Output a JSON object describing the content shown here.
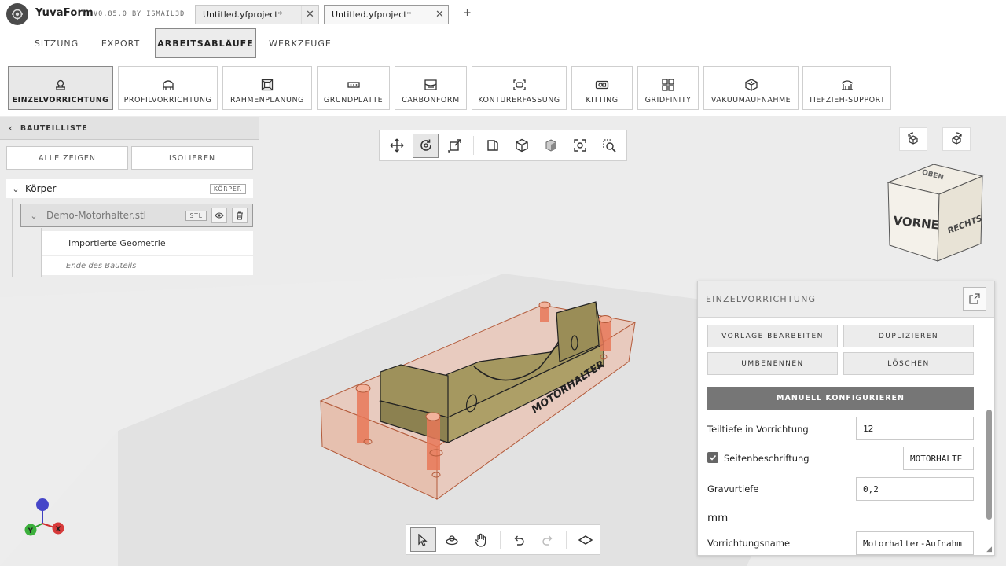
{
  "app": {
    "name": "YuvaForm",
    "version": "V0.85.0 BY ISMAIL3D"
  },
  "doc_tabs": [
    {
      "label": "Untitled.yfproject",
      "modified": "*"
    },
    {
      "label": "Untitled.yfproject",
      "modified": "*"
    }
  ],
  "new_tab_label": "+",
  "menu_tabs": [
    "SITZUNG",
    "EXPORT",
    "ARBEITSABLÄUFE",
    "WERKZEUGE"
  ],
  "active_menu_tab": "ARBEITSABLÄUFE",
  "ribbon": [
    {
      "label": "EINZELVORRICHTUNG",
      "icon": "single-fixture-icon",
      "active": true
    },
    {
      "label": "PROFILVORRICHTUNG",
      "icon": "profile-fixture-icon"
    },
    {
      "label": "RAHMENPLANUNG",
      "icon": "frame-planning-icon"
    },
    {
      "label": "GRUNDPLATTE",
      "icon": "baseplate-icon"
    },
    {
      "label": "CARBONFORM",
      "icon": "carbon-form-icon"
    },
    {
      "label": "KONTURERFASSUNG",
      "icon": "contour-capture-icon"
    },
    {
      "label": "KITTING",
      "icon": "kitting-icon"
    },
    {
      "label": "GRIDFINITY",
      "icon": "gridfinity-icon"
    },
    {
      "label": "VAKUUMAUFNAHME",
      "icon": "vacuum-fixture-icon"
    },
    {
      "label": "TIEFZIEH-SUPPORT",
      "icon": "thermoform-support-icon"
    }
  ],
  "sidebar": {
    "title": "BAUTEILLISTE",
    "show_all": "ALLE ZEIGEN",
    "isolate": "ISOLIEREN",
    "group": {
      "label": "Körper",
      "tag": "KÖRPER"
    },
    "file": {
      "label": "Demo-Motorhalter.stl",
      "tag": "STL"
    },
    "geometry_label": "Importierte Geometrie",
    "end_label": "Ende des Bauteils"
  },
  "view_toolbar_icons": [
    "move-icon",
    "rotate-icon",
    "scale-icon",
    "view-front-icon",
    "view-iso-icon",
    "view-solid-icon",
    "fit-view-icon",
    "zoom-selection-icon"
  ],
  "bottom_toolbar_icons": [
    "select-pointer-icon",
    "orbit-icon",
    "pan-hand-icon",
    "undo-icon",
    "redo-icon",
    "plane-icon"
  ],
  "view_cube": {
    "front": "VORNE",
    "right": "RECHTS",
    "top": "OBEN"
  },
  "model_label": "MOTORHALTER",
  "panel": {
    "title": "EINZELVORRICHTUNG",
    "edit_template": "VORLAGE BEARBEITEN",
    "duplicate": "DUPLIZIEREN",
    "rename": "UMBENENNEN",
    "delete": "LÖSCHEN",
    "configure": "MANUELL KONFIGURIEREN",
    "fields": {
      "part_depth_label": "Teiltiefe in Vorrichtung",
      "part_depth_value": "12",
      "side_label_label": "Seitenbeschriftung",
      "side_label_checked": true,
      "side_label_value": "MOTORHALTE",
      "engrave_depth_label": "Gravurtiefe",
      "engrave_depth_value": "0,2",
      "unit": "mm",
      "fixture_name_label": "Vorrichtungsname",
      "fixture_name_value": "Motorhalter-Aufnahm"
    }
  },
  "axis": {
    "x": "X",
    "y": "Y"
  },
  "colors": {
    "fixture_block": "#e8b8a6",
    "fixture_edge": "#b35a3a",
    "pins": "#e87858",
    "part": "#a39560",
    "config_button": "#767676"
  }
}
